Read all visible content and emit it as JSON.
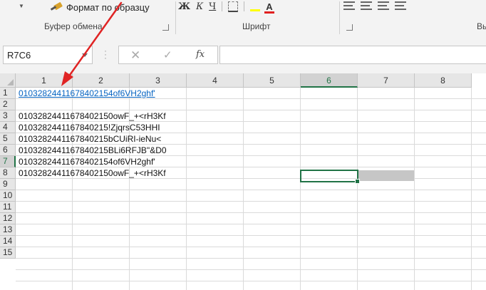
{
  "ribbon": {
    "format_painter_label": "Формат по образцу",
    "clipboard_group": "Буфер обмена",
    "font_group": "Шрифт",
    "styles_group_partial": "Вы",
    "tools": {
      "bold": "Ж",
      "italic": "К",
      "underline": "Ч"
    }
  },
  "formula_bar": {
    "name_box": "R7C6",
    "cancel_glyph": "✕",
    "enter_glyph": "✓",
    "fx_label": "fx",
    "formula": ""
  },
  "grid": {
    "columns": [
      "1",
      "2",
      "3",
      "4",
      "5",
      "6",
      "7",
      "8"
    ],
    "rows": [
      "1",
      "2",
      "3",
      "4",
      "5",
      "6",
      "7",
      "8",
      "9",
      "10",
      "11",
      "12",
      "13",
      "14",
      "15"
    ],
    "selected_column": "6",
    "selected_row": "7",
    "cells": [
      {
        "row": "1",
        "text": "01032824411678402154of6VH2ghf'",
        "hyperlink": true
      },
      {
        "row": "2",
        "text": "",
        "hyperlink": false
      },
      {
        "row": "3",
        "text": "01032824411678402150owF_+<rH3Kf",
        "hyperlink": false
      },
      {
        "row": "4",
        "text": "0103282441167840215!ZjqrsC53HHI",
        "hyperlink": false
      },
      {
        "row": "5",
        "text": "0103282441167840215bCUiRI-ieNu<",
        "hyperlink": false
      },
      {
        "row": "6",
        "text": "0103282441167840215BLi6RFJB\"&D0",
        "hyperlink": false
      },
      {
        "row": "7",
        "text": "01032824411678402154of6VH2ghf'",
        "hyperlink": false
      },
      {
        "row": "8",
        "text": "01032824411678402150owF_+<rH3Kf",
        "hyperlink": false
      }
    ]
  },
  "colors": {
    "selection": "#217346",
    "hyperlink": "#0563c1",
    "annotation_arrow": "#e02424"
  }
}
